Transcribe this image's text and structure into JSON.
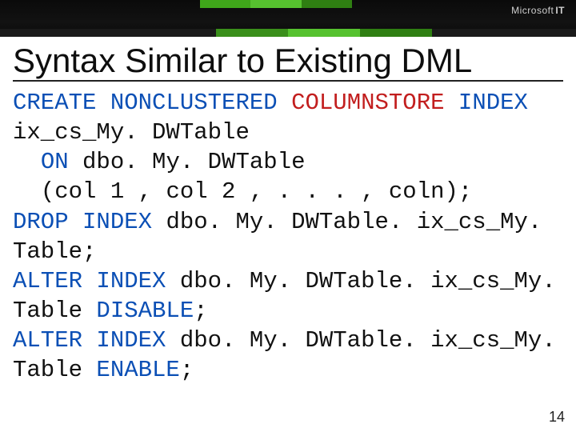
{
  "brand": {
    "company": "Microsoft",
    "unit": "IT"
  },
  "accent_colors": {
    "top_segments": [
      "#3fa61a",
      "#56c22f",
      "#2f7f12"
    ],
    "bottom_segments": [
      "#1a1a1a",
      "#1a1a1a",
      "#1a1a1a",
      "#3a8f1b",
      "#56c22f",
      "#2f7f12",
      "#1a1a1a",
      "#1a1a1a"
    ]
  },
  "title": "Syntax Similar to Existing DML",
  "code": {
    "l1a": "CREATE",
    "l1b": "NONCLUSTERED",
    "l1c": "COLUMNSTORE",
    "l1d": "INDEX",
    "l2a": "ix_cs_My. DWTable",
    "l3a": "  ",
    "l3b": "ON",
    "l3c": " dbo. My. DWTable",
    "l4a": "  (col 1 , col 2 , . . . , coln);",
    "l5a": "DROP",
    "l5b": "INDEX",
    "l5c": " dbo. My. DWTable. ix_cs_My. Table;",
    "l6a": "ALTER",
    "l6b": "INDEX",
    "l6c": " dbo. My. DWTable. ix_cs_My. Table ",
    "l6d": "DISABLE",
    "l6e": ";",
    "l7a": "ALTER",
    "l7b": "INDEX",
    "l7c": " dbo. My. DWTable. ix_cs_My. Table ",
    "l7d": "ENABLE",
    "l7e": ";"
  },
  "page_number": "14"
}
